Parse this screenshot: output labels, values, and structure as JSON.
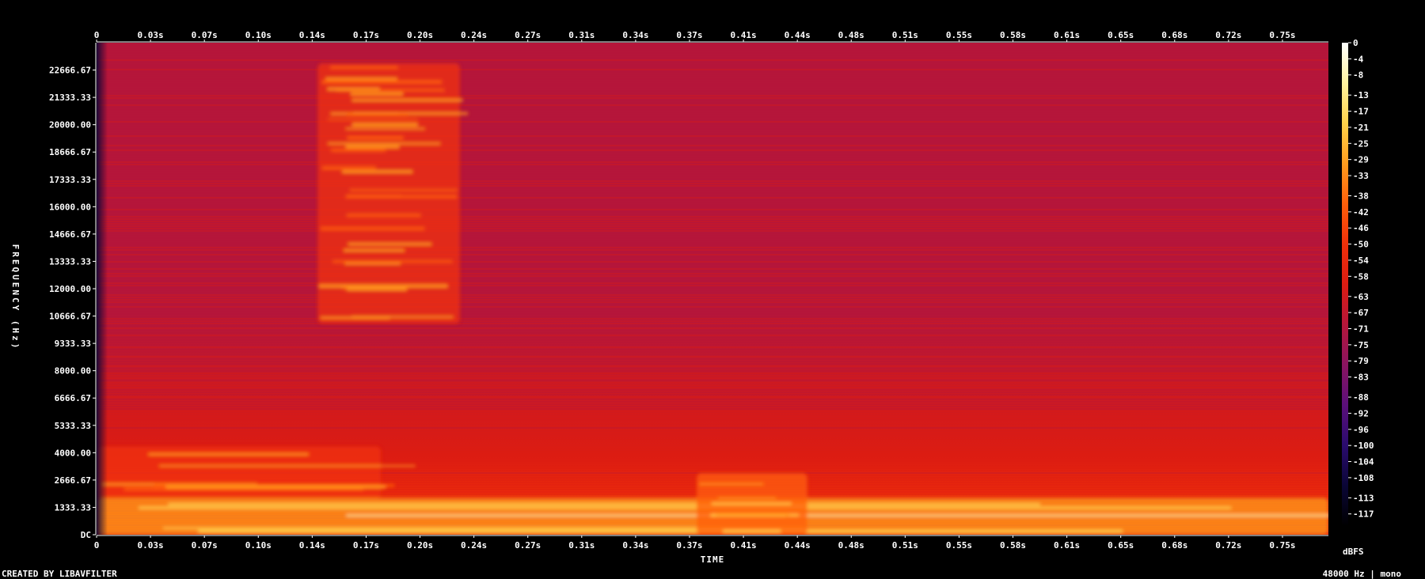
{
  "chart_data": {
    "type": "heatmap",
    "subtype": "spectrogram",
    "title": "",
    "xlabel": "TIME",
    "ylabel": "FREQUENCY (Hz)",
    "x_unit": "s",
    "y_unit": "Hz",
    "x_ticks": [
      "0",
      "0.03s",
      "0.07s",
      "0.10s",
      "0.14s",
      "0.17s",
      "0.20s",
      "0.24s",
      "0.27s",
      "0.31s",
      "0.34s",
      "0.37s",
      "0.41s",
      "0.44s",
      "0.48s",
      "0.51s",
      "0.55s",
      "0.58s",
      "0.61s",
      "0.65s",
      "0.68s",
      "0.72s",
      "0.75s"
    ],
    "xlim": [
      0,
      0.78
    ],
    "y_ticks": [
      "DC",
      "1333.33",
      "2666.67",
      "4000.00",
      "5333.33",
      "6666.67",
      "8000.00",
      "9333.33",
      "10666.67",
      "12000.00",
      "13333.33",
      "14666.67",
      "16000.00",
      "17333.33",
      "18666.67",
      "20000.00",
      "21333.33",
      "22666.67"
    ],
    "ylim": [
      0,
      24000
    ],
    "colorbar": {
      "label": "dBFS",
      "ticks": [
        "0",
        "-4",
        "-8",
        "-13",
        "-17",
        "-21",
        "-25",
        "-29",
        "-33",
        "-38",
        "-42",
        "-46",
        "-50",
        "-54",
        "-58",
        "-63",
        "-67",
        "-71",
        "-75",
        "-79",
        "-83",
        "-88",
        "-92",
        "-96",
        "-100",
        "-104",
        "-108",
        "-113",
        "-117"
      ],
      "range": [
        -120,
        0
      ],
      "colors": [
        "#000000",
        "#0a0636",
        "#2a0b6e",
        "#5a0f7a",
        "#8a1460",
        "#b5163a",
        "#dc1c12",
        "#f0300a",
        "#ff5f0a",
        "#ff9c1e",
        "#ffd24a",
        "#fff3a0",
        "#ffffff"
      ]
    },
    "background_level_db": -68,
    "events": [
      {
        "t_start": 0.0,
        "t_end": 0.78,
        "f_low": 0,
        "f_high": 1800,
        "level_db": -22
      },
      {
        "t_start": 0.0,
        "t_end": 0.18,
        "f_low": 1800,
        "f_high": 4300,
        "level_db": -38
      },
      {
        "t_start": 0.14,
        "t_end": 0.23,
        "f_low": 10300,
        "f_high": 23000,
        "level_db": -40
      },
      {
        "t_start": 0.38,
        "t_end": 0.45,
        "f_low": 0,
        "f_high": 3000,
        "level_db": -34
      }
    ]
  },
  "footer": {
    "left": "CREATED BY LIBAVFILTER",
    "right": "48000 Hz | mono"
  }
}
